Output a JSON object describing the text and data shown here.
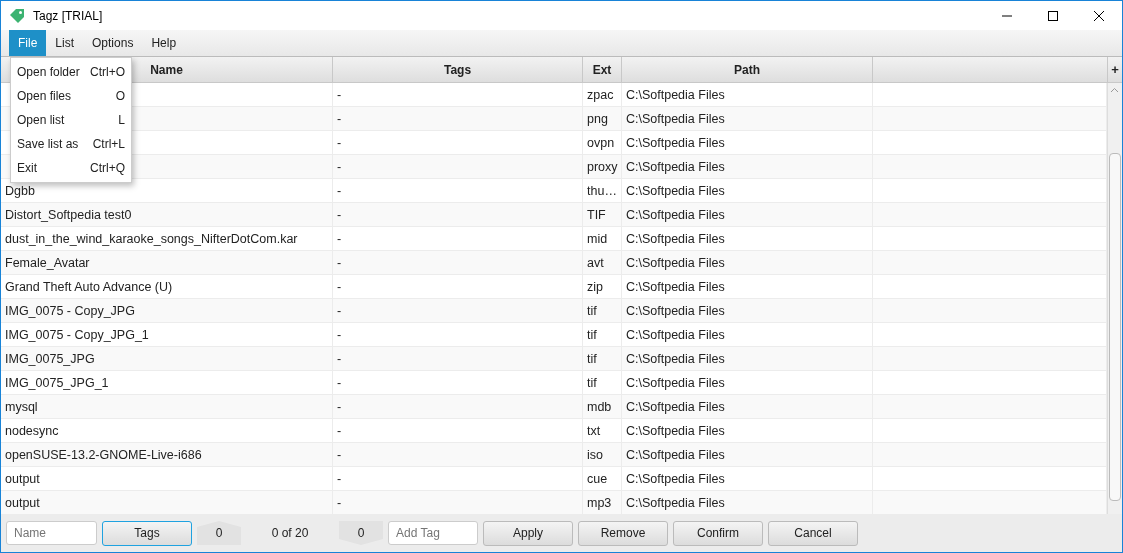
{
  "window": {
    "title": "Tagz [TRIAL]"
  },
  "menu_bar": [
    {
      "label": "File",
      "selected": true
    },
    {
      "label": "List",
      "selected": false
    },
    {
      "label": "Options",
      "selected": false
    },
    {
      "label": "Help",
      "selected": false
    }
  ],
  "file_menu": [
    {
      "label": "Open folder",
      "shortcut": "Ctrl+O"
    },
    {
      "label": "Open files",
      "shortcut": "O"
    },
    {
      "label": "Open list",
      "shortcut": "L"
    },
    {
      "label": "Save list as",
      "shortcut": "Ctrl+L"
    },
    {
      "label": "Exit",
      "shortcut": "Ctrl+Q"
    }
  ],
  "table": {
    "columns": [
      "Name",
      "Tags",
      "Ext",
      "Path"
    ],
    "add_column": "+",
    "rows": [
      {
        "tags": "-",
        "ext": "zpac",
        "path": "C:\\Softpedia Files"
      },
      {
        "tags": "-",
        "ext": "png",
        "path": "C:\\Softpedia Files"
      },
      {
        "tags": "-",
        "ext": "ovpn",
        "path": "C:\\Softpedia Files"
      },
      {
        "tags": "-",
        "ext": "proxy",
        "path": "C:\\Softpedia Files"
      },
      {
        "name": "Dgbb",
        "tags": "-",
        "ext": "thu…",
        "path": "C:\\Softpedia Files"
      },
      {
        "name": "Distort_Softpedia test0",
        "tags": "-",
        "ext": "TIF",
        "path": "C:\\Softpedia Files"
      },
      {
        "name": "dust_in_the_wind_karaoke_songs_NifterDotCom.kar",
        "tags": "-",
        "ext": "mid",
        "path": "C:\\Softpedia Files"
      },
      {
        "name": "Female_Avatar",
        "tags": "-",
        "ext": "avt",
        "path": "C:\\Softpedia Files"
      },
      {
        "name": "Grand Theft Auto Advance (U)",
        "tags": "-",
        "ext": "zip",
        "path": "C:\\Softpedia Files"
      },
      {
        "name": "IMG_0075 - Copy_JPG",
        "tags": "-",
        "ext": "tif",
        "path": "C:\\Softpedia Files"
      },
      {
        "name": "IMG_0075 - Copy_JPG_1",
        "tags": "-",
        "ext": "tif",
        "path": "C:\\Softpedia Files"
      },
      {
        "name": "IMG_0075_JPG",
        "tags": "-",
        "ext": "tif",
        "path": "C:\\Softpedia Files"
      },
      {
        "name": "IMG_0075_JPG_1",
        "tags": "-",
        "ext": "tif",
        "path": "C:\\Softpedia Files"
      },
      {
        "name": "mysql",
        "tags": "-",
        "ext": "mdb",
        "path": "C:\\Softpedia Files"
      },
      {
        "name": "nodesync",
        "tags": "-",
        "ext": "txt",
        "path": "C:\\Softpedia Files"
      },
      {
        "name": "openSUSE-13.2-GNOME-Live-i686",
        "tags": "-",
        "ext": "iso",
        "path": "C:\\Softpedia Files"
      },
      {
        "name": "output",
        "tags": "-",
        "ext": "cue",
        "path": "C:\\Softpedia Files"
      },
      {
        "name": "output",
        "tags": "-",
        "ext": "mp3",
        "path": "C:\\Softpedia Files"
      }
    ]
  },
  "bottom_bar": {
    "name_field": {
      "placeholder": "Name"
    },
    "tags_button": {
      "label": "Tags",
      "selected": true
    },
    "up_count": "0",
    "position": "0 of 20",
    "down_count": "0",
    "add_tag_field": {
      "placeholder": "Add Tag"
    },
    "buttons": [
      "Apply",
      "Remove",
      "Confirm",
      "Cancel"
    ]
  }
}
